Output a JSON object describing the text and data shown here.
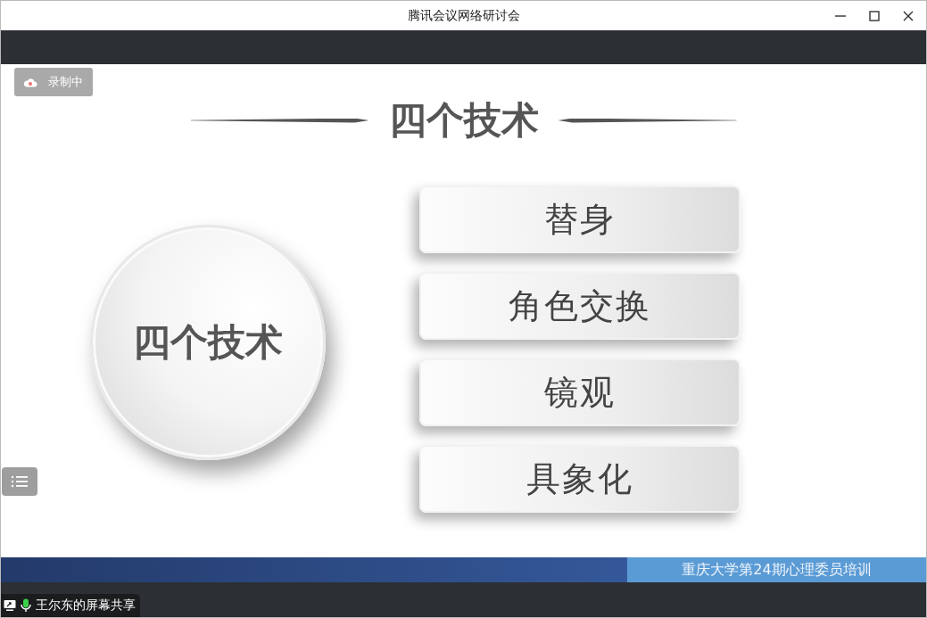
{
  "window": {
    "title": "腾讯会议网络研讨会"
  },
  "recording_badge": {
    "label": "录制中"
  },
  "slide": {
    "title": "四个技术",
    "circle_label": "四个技术",
    "items": [
      "替身",
      "角色交换",
      "镜观",
      "具象化"
    ],
    "footer": "重庆大学第24期心理委员培训"
  },
  "share_label": {
    "text": "王尔东的屏幕共享",
    "mic_on": true
  }
}
